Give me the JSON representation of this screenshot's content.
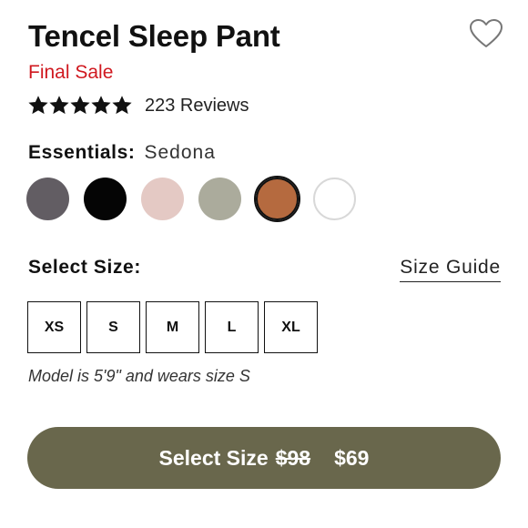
{
  "product": {
    "title": "Tencel Sleep Pant",
    "sale_label": "Final Sale",
    "favorite_icon": "heart-outline-icon"
  },
  "rating": {
    "stars": 5,
    "max": 5,
    "reviews_label": "223 Reviews"
  },
  "color": {
    "label": "Essentials:",
    "selected_name": "Sedona",
    "swatches": [
      {
        "color": "#625d63"
      },
      {
        "color": "#050505"
      },
      {
        "color": "#e4c9c4"
      },
      {
        "color": "#abab9c"
      },
      {
        "color": "#b56a3f",
        "selected": true
      },
      {
        "color": "#ffffff"
      }
    ]
  },
  "size": {
    "label": "Select Size:",
    "guide_label": "Size Guide",
    "options": [
      "XS",
      "S",
      "M",
      "L",
      "XL"
    ],
    "model_note": "Model is 5'9\" and wears size S"
  },
  "cta": {
    "label": "Select Size",
    "original_price": "$98",
    "sale_price": "$69",
    "color": "#69674c"
  },
  "colors": {
    "sale": "#d0181f"
  }
}
